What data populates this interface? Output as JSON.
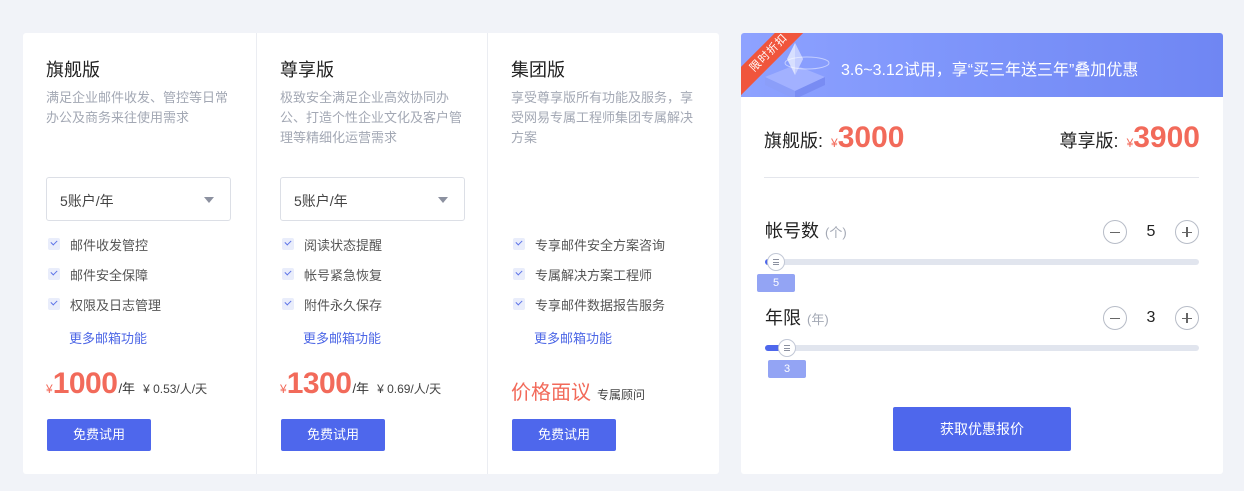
{
  "plans": [
    {
      "title": "旗舰版",
      "description": "满足企业邮件收发、管控等日常办公及商务来往使用需求",
      "select_value": "5账户/年",
      "features": [
        "邮件收发管控",
        "邮件安全保障",
        "权限及日志管理"
      ],
      "more_link": "更多邮箱功能",
      "price": {
        "currency": "¥",
        "amount": "1000",
        "unit": "/年",
        "daily": "¥ 0.53/人/天"
      },
      "trial_button": "免费试用"
    },
    {
      "title": "尊享版",
      "description": "极致安全满足企业高效协同办公、打造个性企业文化及客户管理等精细化运营需求",
      "select_value": "5账户/年",
      "features": [
        "阅读状态提醒",
        "帐号紧急恢复",
        "附件永久保存"
      ],
      "more_link": "更多邮箱功能",
      "price": {
        "currency": "¥",
        "amount": "1300",
        "unit": "/年",
        "daily": "¥ 0.69/人/天"
      },
      "trial_button": "免费试用"
    },
    {
      "title": "集团版",
      "description": "享受尊享版所有功能及服务，享受网易专属工程师集团专属解决方案",
      "features": [
        "专享邮件安全方案咨询",
        "专属解决方案工程师",
        "专享邮件数据报告服务"
      ],
      "more_link": "更多邮箱功能",
      "price_negotiable": {
        "main": "价格面议",
        "sub": "专属顾问"
      },
      "trial_button": "免费试用"
    }
  ],
  "calculator": {
    "ribbon": "限时折扣",
    "promo_text": "3.6~3.12试用，享“买三年送三年”叠加优惠",
    "quotes": [
      {
        "label": "旗舰版:",
        "currency": "¥",
        "amount": "3000"
      },
      {
        "label": "尊享版:",
        "currency": "¥",
        "amount": "3900"
      }
    ],
    "accounts": {
      "label": "帐号数",
      "unit": "(个)",
      "value": "5",
      "slider_fraction": 0.025,
      "bubble": "5"
    },
    "years": {
      "label": "年限",
      "unit": "(年)",
      "value": "3",
      "slider_fraction": 0.05,
      "bubble": "3"
    },
    "submit_button": "获取优惠报价"
  },
  "colors": {
    "accent": "#4e67ec",
    "price": "#f26a5a",
    "ribbon": "#f0553c"
  }
}
